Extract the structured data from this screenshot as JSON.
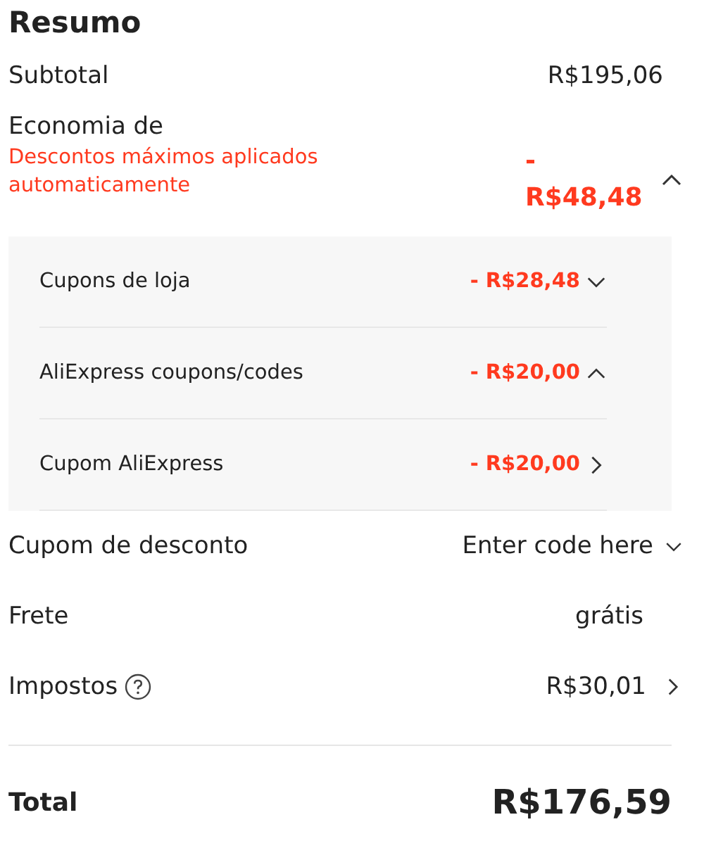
{
  "title": "Resumo",
  "subtotal": {
    "label": "Subtotal",
    "value": "R$195,06"
  },
  "savings": {
    "label": "Economia de",
    "note": "Descontos máximos aplicados automaticamente",
    "value": "- R$48,48",
    "expanded": true
  },
  "coupons": [
    {
      "label": "Cupons de loja",
      "value": "- R$28,48",
      "link": false,
      "expanded": false
    },
    {
      "label": "AliExpress coupons/codes",
      "value": "- R$20,00",
      "link": false,
      "expanded": true
    },
    {
      "label": "Cupom AliExpress",
      "value": "- R$20,00",
      "link": true
    }
  ],
  "discount_code": {
    "label": "Cupom de desconto",
    "placeholder": "Enter code here"
  },
  "shipping": {
    "label": "Frete",
    "value": "grátis"
  },
  "taxes": {
    "label": "Impostos",
    "value": "R$30,01"
  },
  "total": {
    "label": "Total",
    "value": "R$176,59"
  }
}
